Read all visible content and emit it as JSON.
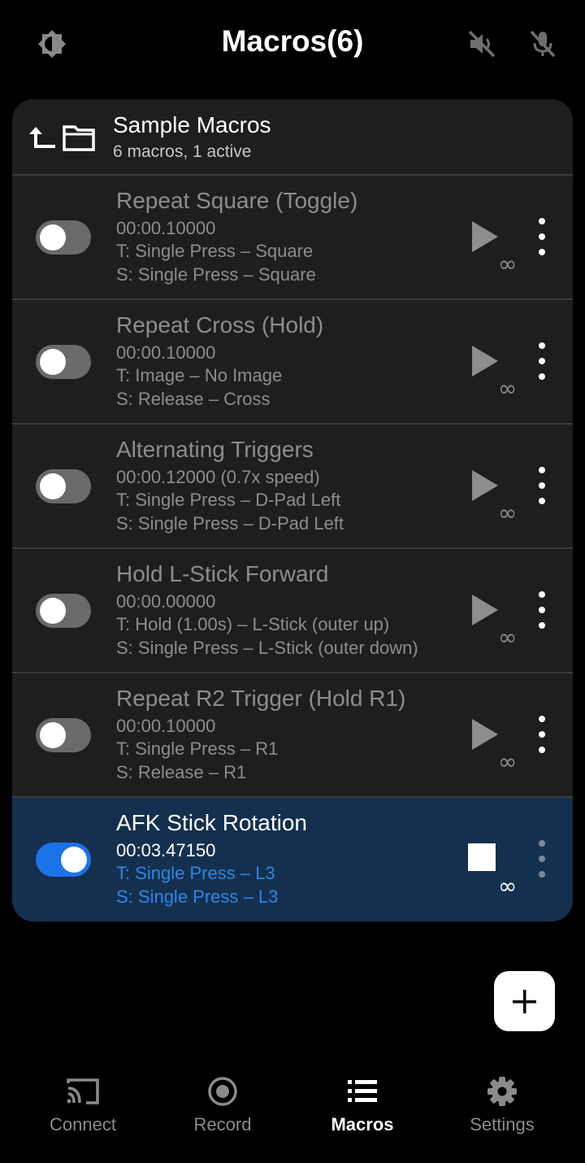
{
  "header": {
    "title": "Macros(6)",
    "left_icon": "brightness-icon",
    "right_icons": [
      "volume-off-icon",
      "mic-off-icon"
    ]
  },
  "folder": {
    "name": "Sample Macros",
    "summary": "6 macros, 1 active"
  },
  "macros": [
    {
      "name": "Repeat Square (Toggle)",
      "time": "00:00.10000",
      "trigger": "T: Single Press – Square",
      "sequence": "S: Single Press – Square",
      "enabled": false,
      "running": false
    },
    {
      "name": "Repeat Cross (Hold)",
      "time": "00:00.10000",
      "trigger": "T: Image – No Image",
      "sequence": "S: Release – Cross",
      "enabled": false,
      "running": false
    },
    {
      "name": "Alternating Triggers",
      "time": "00:00.12000 (0.7x speed)",
      "trigger": "T: Single Press – D-Pad Left",
      "sequence": "S: Single Press – D-Pad Left",
      "enabled": false,
      "running": false
    },
    {
      "name": "Hold L-Stick Forward",
      "time": "00:00.00000",
      "trigger": "T: Hold (1.00s) – L-Stick (outer up)",
      "sequence": "S: Single Press – L-Stick (outer down)",
      "enabled": false,
      "running": false
    },
    {
      "name": "Repeat R2 Trigger (Hold R1)",
      "time": "00:00.10000",
      "trigger": "T: Single Press – R1",
      "sequence": "S: Release – R1",
      "enabled": false,
      "running": false
    },
    {
      "name": "AFK Stick Rotation",
      "time": "00:03.47150",
      "trigger": "T: Single Press – L3",
      "sequence": "S: Single Press – L3",
      "enabled": true,
      "running": true
    }
  ],
  "loop_symbol": "∞",
  "nav": {
    "items": [
      {
        "label": "Connect",
        "icon": "cast-icon",
        "selected": false
      },
      {
        "label": "Record",
        "icon": "record-icon",
        "selected": false
      },
      {
        "label": "Macros",
        "icon": "list-icon",
        "selected": true
      },
      {
        "label": "Settings",
        "icon": "gear-icon",
        "selected": false
      }
    ]
  },
  "colors": {
    "background": "#000000",
    "card": "#1e1e1e",
    "active_row": "#14304e",
    "accent_blue": "#1a73e8",
    "muted_text": "#8d8d8d"
  }
}
